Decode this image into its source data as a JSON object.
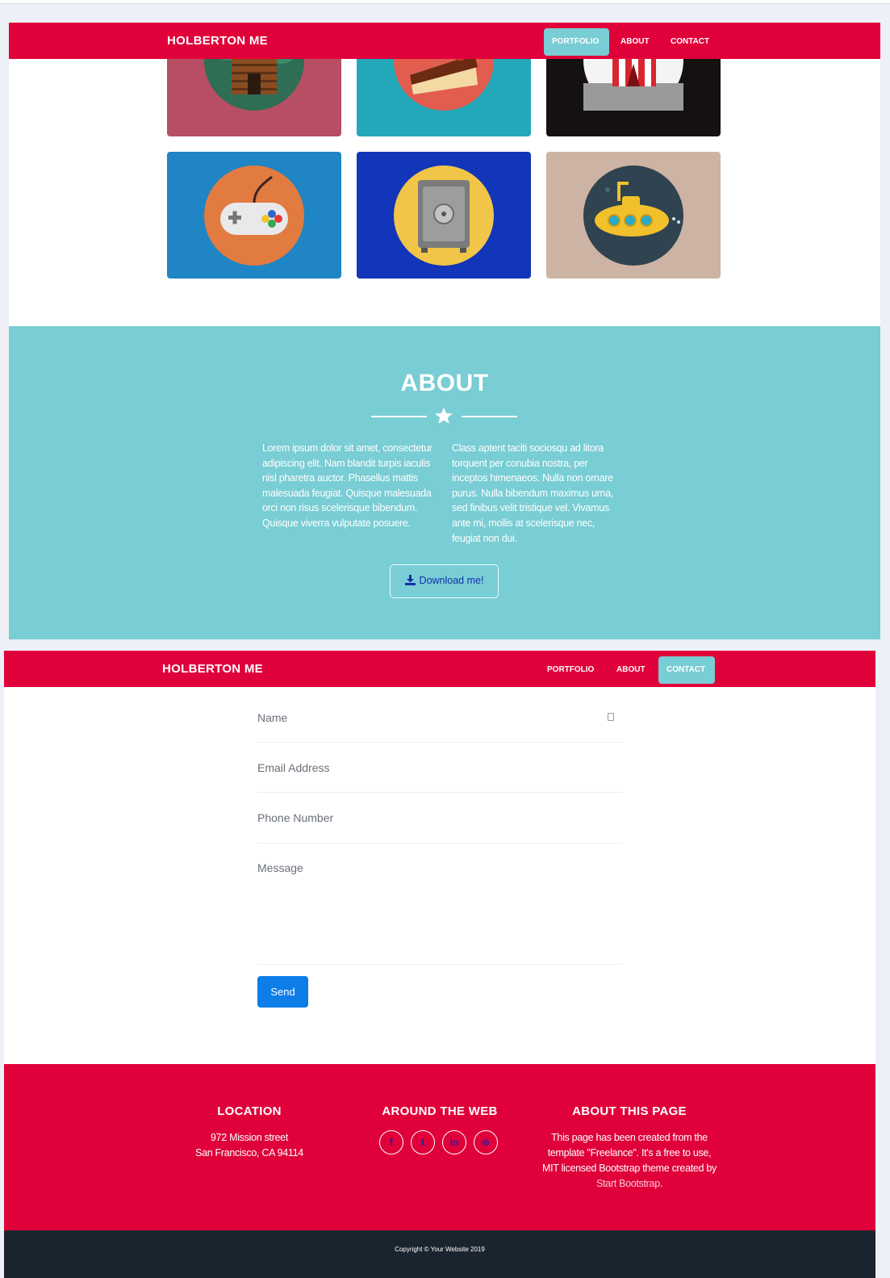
{
  "nav": {
    "brand": "HOLBERTON ME",
    "links": [
      "PORTFOLIO",
      "ABOUT",
      "CONTACT"
    ]
  },
  "portfolio": {
    "tiles": [
      {
        "icon": "cabin-icon",
        "bg": "#b84e63",
        "circle": "#2f6d55"
      },
      {
        "icon": "cake-icon",
        "bg": "#22a8b9",
        "circle": "#e35d4f"
      },
      {
        "icon": "circus-tent-icon",
        "bg": "#161111",
        "circle": "#f4f4f4"
      },
      {
        "icon": "game-controller-icon",
        "bg": "#1f85c5",
        "circle": "#e27b3f"
      },
      {
        "icon": "safe-icon",
        "bg": "#1235b9",
        "circle": "#f1c548"
      },
      {
        "icon": "submarine-icon",
        "bg": "#cdb3a4",
        "circle": "#2f4350"
      }
    ]
  },
  "about": {
    "title": "ABOUT",
    "left_text": "Lorem ipsum dolor sit amet, consectetur adipiscing elit. Nam blandit turpis iaculis nisl pharetra auctor. Phasellus mattis malesuada feugiat. Quisque malesuada orci non risus scelerisque bibendum. Quisque viverra vulputate posuere.",
    "right_text": "Class aptent taciti sociosqu ad litora torquent per conubia nostra, per inceptos himenaeos. Nulla non ornare purus. Nulla bibendum maximus urna, sed finibus velit tristique vel. Vivamus ante mi, mollis at scelerisque nec, feugiat non dui.",
    "download_label": "Download me!"
  },
  "contact": {
    "name_placeholder": "Name",
    "email_placeholder": "Email Address",
    "phone_placeholder": "Phone Number",
    "message_placeholder": "Message",
    "send_label": "Send"
  },
  "footer": {
    "location_title": "LOCATION",
    "location_line1": "972 Mission street",
    "location_line2": "San Francisco, CA 94114",
    "web_title": "AROUND THE WEB",
    "social": [
      {
        "icon": "facebook-icon",
        "glyph": "f"
      },
      {
        "icon": "twitter-icon",
        "glyph": "t"
      },
      {
        "icon": "linkedin-icon",
        "glyph": "in"
      },
      {
        "icon": "dribbble-icon",
        "glyph": "⊛"
      }
    ],
    "about_title": "ABOUT THIS PAGE",
    "about_text_1": "This page has been created from the template \"Freelance\". It's a free to use, MIT licensed Bootstrap theme created by",
    "about_link": "Start Bootstrap",
    "about_text_2": ".",
    "copyright": "Copyright © Your Website 2019"
  },
  "colors": {
    "brand_red": "#e0003a",
    "teal": "#79cdd4",
    "send_blue": "#0d7de8",
    "dark": "#1a242e"
  }
}
